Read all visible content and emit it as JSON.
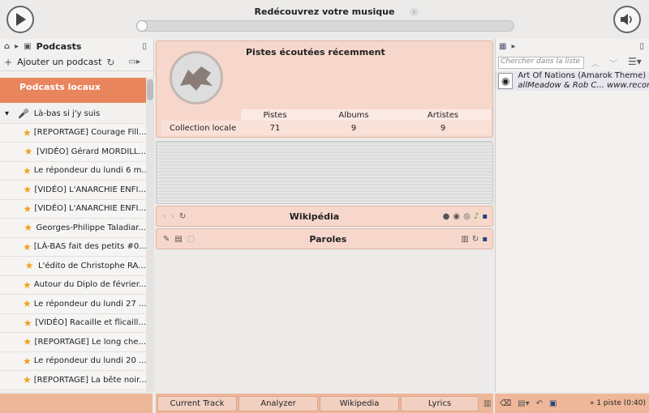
{
  "player": {
    "title": "Redécouvrez votre musique"
  },
  "left_panel": {
    "breadcrumb": "Podcasts",
    "add_podcast": "Ajouter un podcast",
    "header": "Podcasts locaux",
    "channel": "Là-bas si j'y suis",
    "episodes": [
      "[REPORTAGE] Courage Fill...",
      "[VIDÉO] Gérard MORDILL...",
      "Le répondeur du lundi 6 m...",
      "[VIDÉO] L'ANARCHIE ENFI...",
      "[VIDÉO] L'ANARCHIE ENFI...",
      "Georges-Philippe Taladiar...",
      "[LÀ-BAS fait des petits #0...",
      "L'édito de Christophe RA...",
      "Autour du Diplo de février...",
      "Le répondeur du lundi 27 ...",
      "[VIDÉO] Racaille et flicaill...",
      "[REPORTAGE] Le long che...",
      "Le répondeur du lundi 20 ...",
      "[REPORTAGE] La bête noir..."
    ]
  },
  "recent": {
    "title": "Pistes écoutées récemment",
    "headers": [
      "Pistes",
      "Albums",
      "Artistes"
    ],
    "row_label": "Collection locale",
    "values": [
      "71",
      "9",
      "9"
    ]
  },
  "applets": {
    "wikipedia": "Wikipédia",
    "lyrics": "Paroles"
  },
  "playlist": {
    "search_placeholder": "Chercher dans la liste",
    "track_title": "Art Of Nations (Amarok Theme)",
    "track_artist": "allMeadow & Rob C...",
    "track_url": "www.reconstr",
    "status": "1 piste (0:40)"
  },
  "bottom_tabs": [
    "Current Track",
    "Analyzer",
    "Wikipedia",
    "Lyrics"
  ],
  "colors": {
    "accent": "#e8855d",
    "applet_bg": "#f7d7cc",
    "bottom_bar": "#efb79a"
  }
}
